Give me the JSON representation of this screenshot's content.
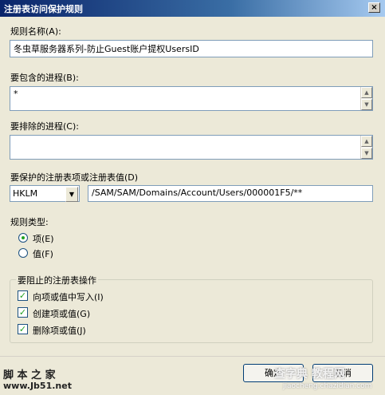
{
  "window": {
    "title": "注册表访问保护规则",
    "close_glyph": "×"
  },
  "rule_name": {
    "label": "规则名称(A):",
    "value": "冬虫草服务器系列-防止Guest账户提权UsersID"
  },
  "include": {
    "label": "要包含的进程(B):",
    "value": "*"
  },
  "exclude": {
    "label": "要排除的进程(C):",
    "value": ""
  },
  "protect": {
    "label": "要保护的注册表项或注册表值(D)",
    "hive": "HKLM",
    "path": "/SAM/SAM/Domains/Account/Users/000001F5/**"
  },
  "rule_type": {
    "label": "规则类型:",
    "options": [
      {
        "label": "项(E)",
        "selected": true
      },
      {
        "label": "值(F)",
        "selected": false
      }
    ]
  },
  "block_ops": {
    "label": "要阻止的注册表操作",
    "items": [
      {
        "label": "向项或值中写入(I)",
        "checked": true
      },
      {
        "label": "创建项或值(G)",
        "checked": true
      },
      {
        "label": "删除项或值(J)",
        "checked": true
      }
    ]
  },
  "buttons": {
    "ok": "确定",
    "cancel": "取消"
  },
  "watermarks": {
    "left_top": "脚 本 之 家",
    "left_bottom": "www.Jb51.net",
    "right_top": "查字典 教程网",
    "right_bottom": "jiaocheng.chazidian.com"
  }
}
